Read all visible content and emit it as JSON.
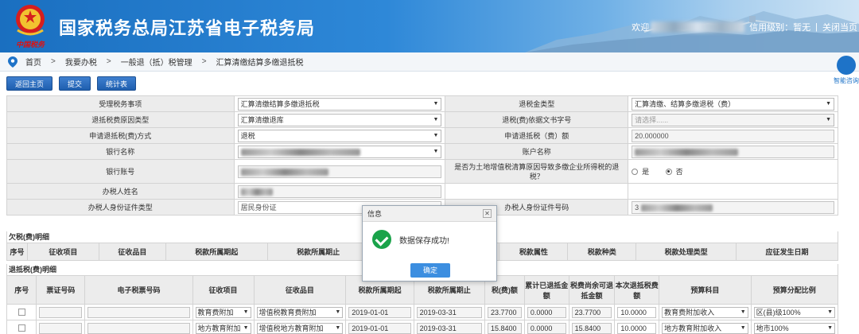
{
  "header": {
    "title": "国家税务总局江苏省电子税务局",
    "emblem_caption": "中国税务",
    "welcome": "欢迎",
    "credit_label": "信用级别：暂无",
    "close_label": "关闭当页",
    "separator": "|"
  },
  "breadcrumb": [
    "首页",
    "我要办税",
    "一般退（抵）税管理",
    "汇算清缴结算多缴退抵税"
  ],
  "breadcrumb_sep": ">",
  "assistant_label": "智能咨询",
  "toolbar": [
    "返回主页",
    "提交",
    "统计表"
  ],
  "form": {
    "rows": [
      {
        "l1": "受理税务事项",
        "v1": "汇算清缴结算多缴退抵税",
        "t1": "select",
        "l2": "退税金类型",
        "v2": "汇算清缴、结算多缴退税（费）",
        "t2": "select"
      },
      {
        "l1": "退抵税费原因类型",
        "v1": "汇算清缴退库",
        "t1": "select",
        "l2": "退税(费)依据文书字号",
        "v2": "请选择......",
        "t2": "select-dis"
      },
      {
        "l1": "申请退抵税(费)方式",
        "v1": "退税",
        "t1": "select",
        "l2": "申请退抵税（费）额",
        "v2": "20.000000",
        "t2": "text-dis"
      },
      {
        "l1": "银行名称",
        "v1": "",
        "t1": "select-blur",
        "l2": "账户名称",
        "v2": "",
        "t2": "text-blur"
      }
    ],
    "bank_account_label": "银行账号",
    "land_question": "是否为土地增值税清算原因导致多缴企业所得税的退税？",
    "radio_yes": "是",
    "radio_no": "否",
    "handler_name_label": "办税人姓名",
    "id_type_label": "办税人身份证件类型",
    "id_type_value": "居民身份证",
    "id_no_label": "办税人身份证件号码",
    "id_no_prefix": "3"
  },
  "arrears": {
    "title": "欠税(费)明细",
    "columns": [
      "序号",
      "征收项目",
      "征收品目",
      "税款所属期起",
      "税款所属期止",
      "",
      "税款属性",
      "税款种类",
      "税款处理类型",
      "应征发生日期"
    ]
  },
  "refund": {
    "title": "退抵税(费)明细",
    "columns": [
      "序号",
      "票证号码",
      "电子税票号码",
      "征收项目",
      "征收品目",
      "税款所属期起",
      "税款所属期止",
      "税(费)额",
      "累计已退抵金额",
      "税费尚余可退抵金额",
      "本次退抵税费额",
      "预算科目",
      "预算分配比例"
    ],
    "rows": [
      {
        "item": "教育费附加",
        "sub": "增值税教育费附加",
        "start": "2019-01-01",
        "end": "2019-03-31",
        "tax": "23.7700",
        "refunded": "0.0000",
        "remain": "23.7700",
        "current": "10.0000",
        "budget": "教育费附加收入",
        "ratio": "区(县)级100%"
      },
      {
        "item": "地方教育附加",
        "sub": "增值税地方教育附加",
        "start": "2019-01-01",
        "end": "2019-03-31",
        "tax": "15.8400",
        "refunded": "0.0000",
        "remain": "15.8400",
        "current": "10.0000",
        "budget": "地方教育附加收入",
        "ratio": "地市100%"
      }
    ]
  },
  "modal": {
    "title": "信息",
    "message": "数据保存成功!",
    "ok": "确定",
    "close": "✕"
  },
  "colors": {
    "header_blue": "#1a6fc0",
    "button_blue": "#1f5faf",
    "success_green": "#1aa34a",
    "ok_blue": "#3c8ee0"
  }
}
